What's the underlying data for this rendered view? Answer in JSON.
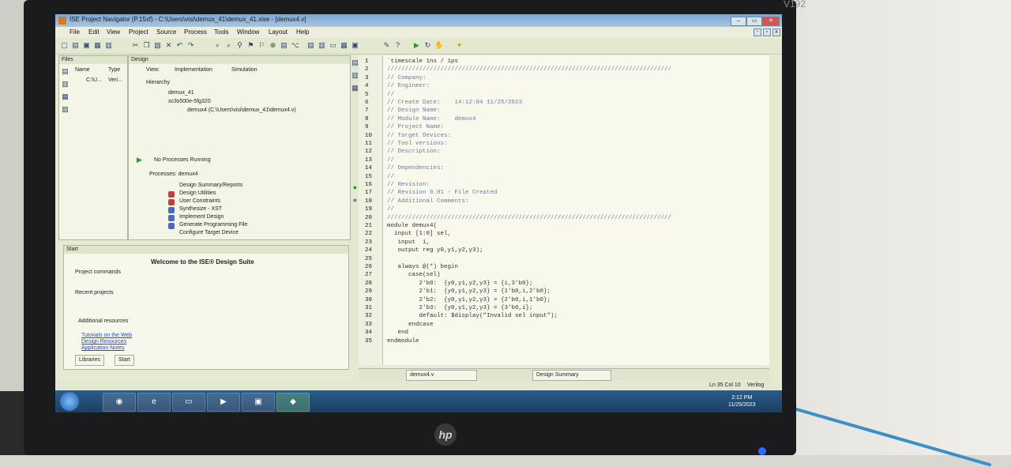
{
  "monitor": {
    "model": "V192",
    "brand": "hp"
  },
  "window": {
    "title": "ISE Project Navigator (P.15xf) - C:\\Users\\visi\\demux_41\\demux_41.xise - [demux4.v]",
    "buttons": [
      "–",
      "▭",
      "✕"
    ]
  },
  "menu": [
    "File",
    "Edit",
    "View",
    "Project",
    "Source",
    "Process",
    "Tools",
    "Window",
    "Layout",
    "Help"
  ],
  "files_panel": {
    "title": "Files",
    "col_name": "Name",
    "col_type": "Type",
    "row_name": "C:\\U...",
    "row_type": "Veri..."
  },
  "design_panel": {
    "title": "Design",
    "view_label": "View:",
    "view_impl": "Implementation",
    "view_sim": "Simulation",
    "hierarchy_label": "Hierarchy",
    "tree": [
      "demux_41",
      "xc3s500e-5fg320",
      "demux4 (C:\\Users\\visi\\demux_41\\demux4.v)"
    ],
    "no_processes": "No Processes Running",
    "processes_label": "Processes: demux4",
    "processes": [
      "Design Summary/Reports",
      "Design Utilities",
      "User Constraints",
      "Synthesize - XST",
      "Implement Design",
      "Generate Programming File",
      "Configure Target Device"
    ]
  },
  "start_panel": {
    "title": "Start",
    "welcome": "Welcome to the ISE® Design Suite",
    "project_commands": "Project commands",
    "recent_projects": "Recent projects",
    "additional_resources": "Additional resources",
    "links": [
      "Tutorials on the Web",
      "Design Resources",
      "Application Notes"
    ],
    "tab_libraries": "Libraries",
    "tab_start": "Start"
  },
  "editor": {
    "lines": [
      "`timescale 1ns / 1ps",
      "////////////////////////////////////////////////////////////////////////////////",
      "// Company:",
      "// Engineer:",
      "//",
      "// Create Date:    14:12:04 11/25/2023",
      "// Design Name:",
      "// Module Name:    demux4",
      "// Project Name:",
      "// Target Devices:",
      "// Tool versions:",
      "// Description:",
      "//",
      "// Dependencies:",
      "//",
      "// Revision:",
      "// Revision 0.01 - File Created",
      "// Additional Comments:",
      "//",
      "////////////////////////////////////////////////////////////////////////////////",
      "module demux4(",
      "  input [1:0] sel,",
      "   input  i,",
      "   output reg y0,y1,y2,y3);",
      "",
      "   always @(*) begin",
      "      case(sel)",
      "         2'b0:  {y0,y1,y2,y3} = {i,3'b0};",
      "         2'b1:  {y0,y1,y2,y3} = {1'b0,i,2'b0};",
      "         2'b2:  {y0,y1,y2,y3} = {2'b0,i,1'b0};",
      "         2'b3:  {y0,y1,y2,y3} = {3'b0,i};",
      "         default: $display(\"Invalid sel input\");",
      "      endcase",
      "   end",
      "endmodule"
    ],
    "tab_file": "demux4.v",
    "tab_summary": "Design Summary"
  },
  "status": {
    "position": "Ln 35 Col 10",
    "language": "Verilog"
  },
  "taskbar": {
    "time": "2:12 PM",
    "date": "11/25/2023"
  }
}
